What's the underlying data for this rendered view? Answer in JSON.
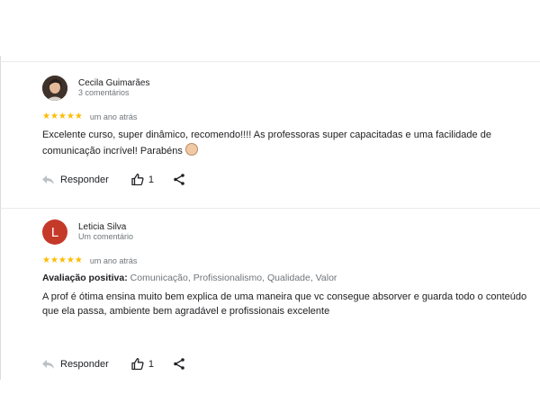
{
  "reviews": [
    {
      "name": "Cecila Guimarães",
      "meta": "3 comentários",
      "stars": "★★★★★",
      "date": "um ano atrás",
      "text": "Excelente curso, super dinâmico, recomendo!!!! As professoras super capacitadas e uma facilidade de comunicação incrível! Parabéns",
      "reply_label": "Responder",
      "likes": "1"
    },
    {
      "avatar_letter": "L",
      "name": "Leticia Silva",
      "meta": "Um comentário",
      "stars": "★★★★★",
      "date": "um ano atrás",
      "positive_label": "Avaliação positiva:",
      "positive_values": "Comunicação, Profissionalismo, Qualidade, Valor",
      "text": "A prof é ótima ensina muito bem explica de uma maneira que vc consegue absorver e guarda todo o conteúdo que ela passa, ambiente bem agradável  e profissionais excelente",
      "reply_label": "Responder",
      "likes": "1"
    }
  ],
  "colors": {
    "star": "#fbbc04",
    "letter_avatar": "#c53929"
  }
}
